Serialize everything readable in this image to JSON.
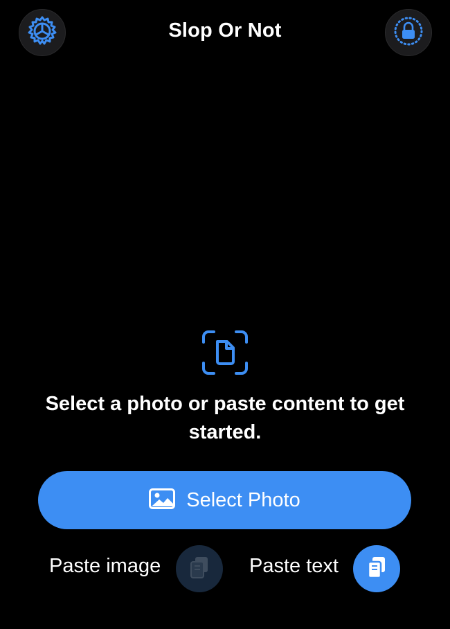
{
  "header": {
    "title": "Slop Or Not",
    "settings_icon": "gear-icon",
    "privacy_icon": "lock-icon"
  },
  "main": {
    "scan_icon": "document-scan-icon",
    "prompt": "Select a photo or paste content to get started.",
    "select_photo_label": "Select Photo",
    "select_photo_icon": "photo-icon"
  },
  "paste": {
    "image_label": "Paste image",
    "text_label": "Paste text",
    "icon": "paste-icon"
  },
  "colors": {
    "accent": "#3d8ef3",
    "background": "#000000",
    "button_dark": "#1c1c1e",
    "disabled_button": "#18283c"
  }
}
